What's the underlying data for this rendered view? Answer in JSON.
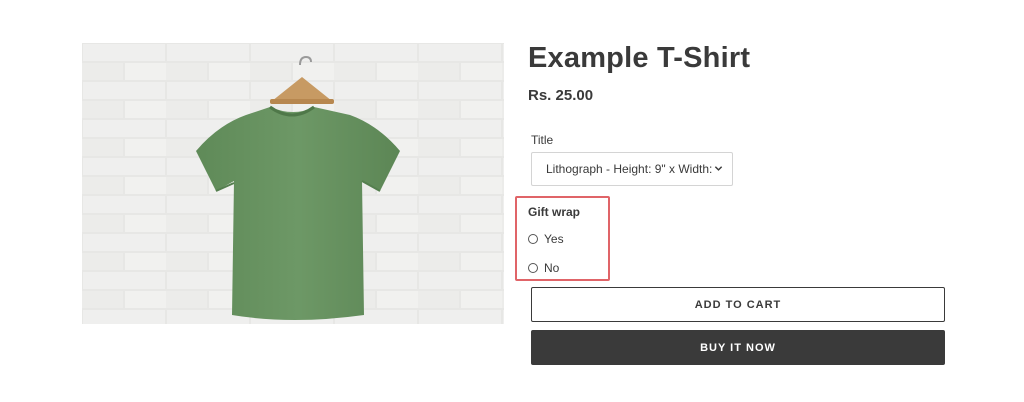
{
  "product": {
    "title": "Example T-Shirt",
    "price": "Rs. 25.00",
    "image_icon": "green-tshirt-on-hanger-photo"
  },
  "options": {
    "title_label": "Title",
    "title_selected": "Lithograph - Height: 9\" x Width:",
    "chevron_icon": "chevron-down-icon"
  },
  "gift_wrap": {
    "label": "Gift wrap",
    "options": [
      "Yes",
      "No"
    ],
    "highlight_color": "#e06468"
  },
  "buttons": {
    "add_to_cart": "ADD TO CART",
    "buy_now": "BUY IT NOW"
  },
  "colors": {
    "text": "#3a3a3a",
    "shirt": "#6b9563",
    "brick": "#e6e6e4"
  }
}
